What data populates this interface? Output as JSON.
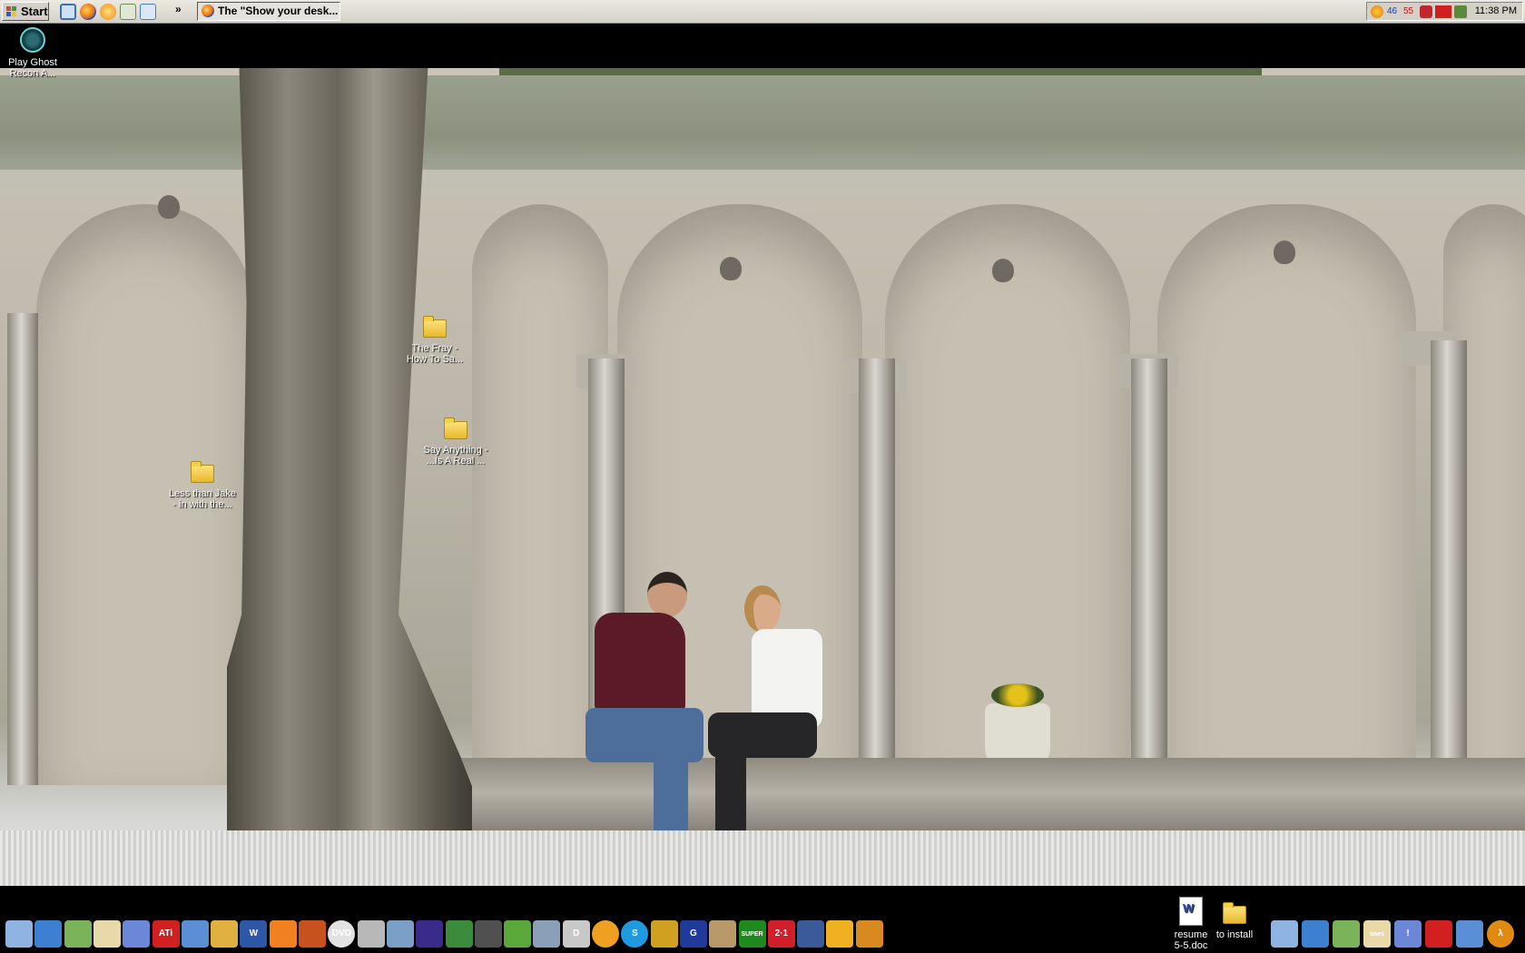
{
  "taskbar": {
    "start_label": "Start",
    "quick_launch": [
      "ie-icon",
      "firefox-icon",
      "firefox-alt-icon",
      "itunes-icon",
      "windows-explorer-icon"
    ],
    "overflow_label": "»",
    "tasks": [
      {
        "label": "The \"Show your desk...",
        "icon": "firefox-icon"
      }
    ],
    "tray": {
      "temp_1": "46",
      "temp_2": "55",
      "clock": "11:38 PM"
    }
  },
  "desktop": {
    "icons": [
      {
        "label_line1": "Play Ghost",
        "label_line2": "Recon A...",
        "icon": "ghost-recon-icon"
      },
      {
        "label_line1": "The Fray -",
        "label_line2": "How To Sa...",
        "icon": "folder-icon"
      },
      {
        "label_line1": "Say Anything -",
        "label_line2": "...Is A Real ...",
        "icon": "folder-icon"
      },
      {
        "label_line1": "Less than Jake",
        "label_line2": "- in with the...",
        "icon": "folder-icon"
      },
      {
        "label_line1": "resume",
        "label_line2": "5-5.doc",
        "icon": "word-document-icon"
      },
      {
        "label_line1": "to install",
        "label_line2": "",
        "icon": "folder-icon"
      }
    ]
  },
  "dock": {
    "items": [
      {
        "name": "finder-icon",
        "text": ""
      },
      {
        "name": "network-icon",
        "text": ""
      },
      {
        "name": "recycle-bin-icon",
        "text": ""
      },
      {
        "name": "mail-icon",
        "text": ""
      },
      {
        "name": "settings-gear-icon",
        "text": ""
      },
      {
        "name": "ati-icon",
        "text": "ATi"
      },
      {
        "name": "power-icon",
        "text": ""
      },
      {
        "name": "target-icon",
        "text": ""
      },
      {
        "name": "word-icon",
        "text": "W"
      },
      {
        "name": "vlc-icon",
        "text": ""
      },
      {
        "name": "clapper-icon",
        "text": ""
      },
      {
        "name": "dvd-icon",
        "text": "DVD"
      },
      {
        "name": "pen-icon",
        "text": ""
      },
      {
        "name": "tools-icon",
        "text": ""
      },
      {
        "name": "flame-icon",
        "text": ""
      },
      {
        "name": "feather-icon",
        "text": ""
      },
      {
        "name": "speaker-icon",
        "text": ""
      },
      {
        "name": "folder-green-icon",
        "text": ""
      },
      {
        "name": "drive-icon",
        "text": ""
      },
      {
        "name": "scaler-icon",
        "text": "D"
      },
      {
        "name": "orange-list-icon",
        "text": ""
      },
      {
        "name": "skype-icon",
        "text": "S"
      },
      {
        "name": "wings-icon",
        "text": ""
      },
      {
        "name": "gigabyte-icon",
        "text": "G"
      },
      {
        "name": "film-reel-icon",
        "text": ""
      },
      {
        "name": "super-icon",
        "text": "SUPER"
      },
      {
        "name": "red-tile-icon",
        "text": "2·1"
      },
      {
        "name": "cpu-z-icon",
        "text": ""
      },
      {
        "name": "lightning-icon",
        "text": ""
      },
      {
        "name": "gears-icon",
        "text": ""
      },
      {
        "name": "android-head-icon",
        "text": ""
      },
      {
        "name": "chart-icon",
        "text": ""
      },
      {
        "name": "golf-icon",
        "text": ""
      },
      {
        "name": "snes-icon",
        "text": "snes"
      },
      {
        "name": "exclamation-icon",
        "text": "!"
      },
      {
        "name": "eye-icon",
        "text": ""
      },
      {
        "name": "portrait-icon",
        "text": ""
      },
      {
        "name": "half-life-icon",
        "text": "λ"
      }
    ]
  },
  "colors": {
    "taskbar_bg": "#d4d0c8",
    "desktop_bg": "#000000",
    "icon_text": "#ffffff",
    "folder_yellow": "#f4cf4c"
  }
}
